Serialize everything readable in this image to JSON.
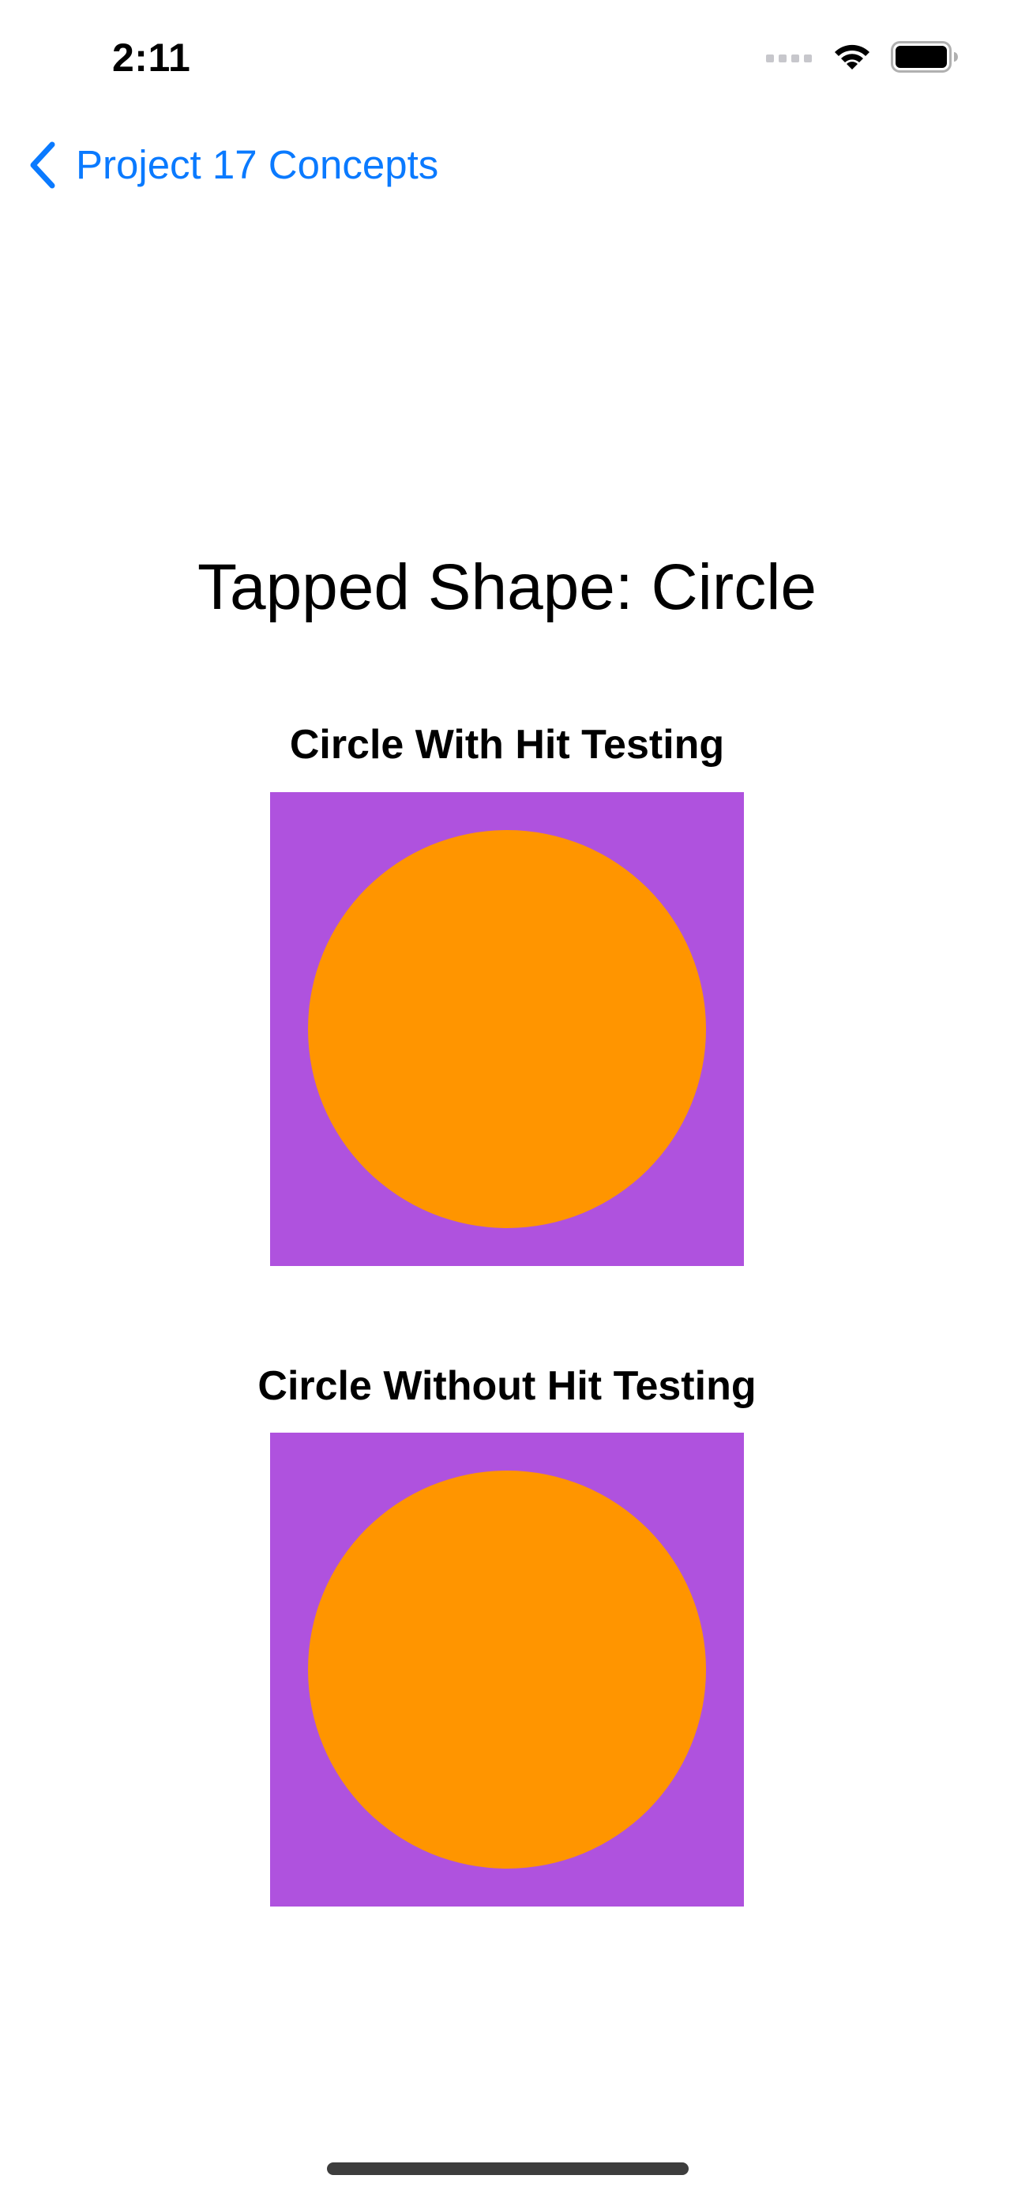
{
  "status_bar": {
    "time": "2:11",
    "icons": [
      "signal-icon",
      "wifi-icon",
      "battery-icon"
    ]
  },
  "nav": {
    "back_label": "Project 17 Concepts",
    "back_icon": "chevron-left-icon",
    "tint_color": "#0a7aff"
  },
  "main": {
    "title": "Tapped Shape: Circle",
    "sections": [
      {
        "label": "Circle With Hit Testing",
        "frame_color": "#af52de",
        "circle_color": "#ff9500"
      },
      {
        "label": "Circle Without Hit Testing",
        "frame_color": "#af52de",
        "circle_color": "#ff9500"
      }
    ]
  }
}
